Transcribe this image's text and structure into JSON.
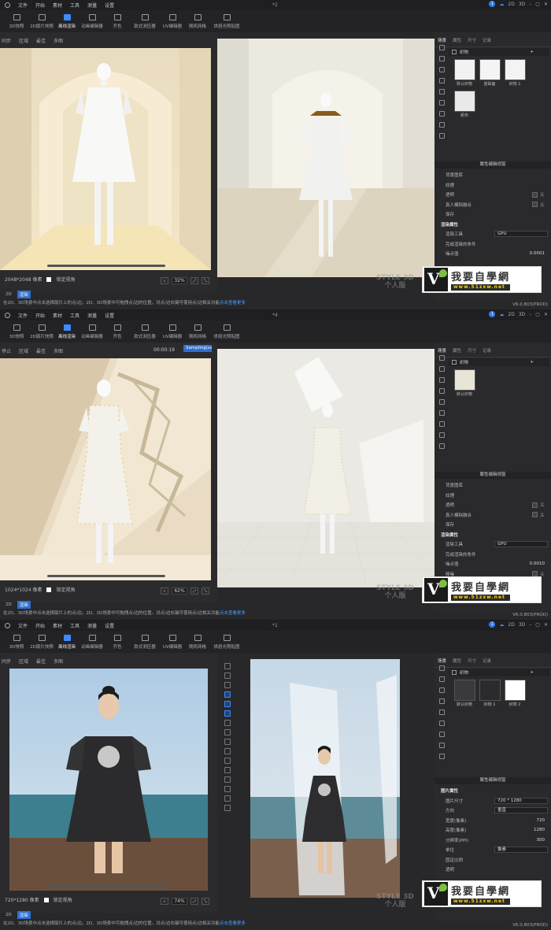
{
  "menu": [
    "文件",
    "开始",
    "素材",
    "工具",
    "测量",
    "设置"
  ],
  "toolbar": [
    {
      "label": "3D快照",
      "icon": "camera-icon"
    },
    {
      "label": "2D版片快照",
      "icon": "pattern-camera-icon"
    },
    {
      "label": "离线渲染",
      "icon": "render-icon",
      "active": true
    },
    {
      "label": "动画编辑器",
      "icon": "animation-icon"
    },
    {
      "label": "齐色",
      "icon": "colorway-icon"
    },
    {
      "label": "款式测压器",
      "icon": "pressure-icon"
    },
    {
      "label": "UV编辑器",
      "icon": "uv-icon"
    },
    {
      "label": "随机网格",
      "icon": "mesh-icon"
    },
    {
      "label": "烘焙光照贴图",
      "icon": "bake-icon"
    }
  ],
  "right_top": {
    "badge": "1",
    "mode_2d": "2D",
    "mode_3d": "3D"
  },
  "right_tabs": [
    "场景",
    "属性",
    "尺寸",
    "记录"
  ],
  "panes": [
    {
      "tab_title": "*2",
      "view_tools": [
        "同步",
        "区域",
        "最佳",
        "多图"
      ],
      "resolution": "2048*2048 像素",
      "lock_label": "锁定视角",
      "zoom": "32%",
      "library_title": "织物",
      "thumbs": [
        {
          "caption": "默认织物"
        },
        {
          "caption": "基础面"
        },
        {
          "caption": "织物 1"
        },
        {
          "caption": "帆布"
        }
      ],
      "prop_header": "属性编辑视窗",
      "props": [
        {
          "label": "背景图库"
        },
        {
          "label": "纹理"
        },
        {
          "label": "透明",
          "value": "关"
        },
        {
          "label": "真人模拟融合",
          "value": "关"
        },
        {
          "label": "保存"
        },
        {
          "label": "渲染属性",
          "section": true
        },
        {
          "label": "渲染工具",
          "dropdown": "GPU"
        },
        {
          "label": "完成渲染的条件"
        },
        {
          "label": "噪点值",
          "value": "0.0001"
        }
      ],
      "mode_tabs": [
        "2D",
        "渲染"
      ]
    },
    {
      "tab_title": "*4",
      "view_tools": [
        "停止",
        "区域",
        "最佳",
        "多图"
      ],
      "timer": "00:00:19",
      "progress_chip": "Sampling(samples)",
      "resolution": "1024*1024 像素",
      "lock_label": "锁定视角",
      "zoom": "62%",
      "library_title": "织物",
      "thumbs": [
        {
          "caption": "默认织物"
        }
      ],
      "prop_header": "属性编辑视窗",
      "props": [
        {
          "label": "背景图库"
        },
        {
          "label": "纹理"
        },
        {
          "label": "透明",
          "value": "关"
        },
        {
          "label": "真人模拟融合",
          "value": "关"
        },
        {
          "label": "保存"
        },
        {
          "label": "渲染属性",
          "section": true
        },
        {
          "label": "渲染工具",
          "dropdown": "GPU"
        },
        {
          "label": "完成渲染的条件"
        },
        {
          "label": "噪点值",
          "value": "0.0010"
        },
        {
          "label": "降噪",
          "value": "关"
        }
      ],
      "mode_tabs": [
        "2D",
        "渲染"
      ]
    },
    {
      "tab_title": "*1",
      "view_tools": [
        "同步",
        "区域",
        "最佳",
        "多图"
      ],
      "resolution": "720*1280 像素",
      "lock_label": "锁定视角",
      "zoom": "74%",
      "library_title": "织物",
      "thumbs": [
        {
          "caption": "默认织物"
        },
        {
          "caption": "织物 1"
        },
        {
          "caption": "织物 2"
        }
      ],
      "prop_header": "属性编辑视窗",
      "props": [
        {
          "label": "图片属性",
          "section": true
        },
        {
          "label": "图片尺寸",
          "dropdown": "720 * 1280"
        },
        {
          "label": "方向",
          "dropdown": "垂直"
        },
        {
          "label": "宽度(像素)",
          "value": "720"
        },
        {
          "label": "高度(像素)",
          "value": "1280"
        },
        {
          "label": "分辨率(PPI)",
          "value": "300"
        },
        {
          "label": "单位",
          "dropdown": "像素"
        },
        {
          "label": "固定比例"
        },
        {
          "label": "透明"
        }
      ],
      "mode_tabs": [
        "2D",
        "渲染"
      ]
    }
  ],
  "hint_text": "在2D、3D场景中点击选择版片上的点/边。2D、3D场景中可拖拽点/边的位置。对点/边右键可使用点/边相关功能",
  "hint_link": "点击查看更多",
  "watermark": {
    "line1": "STYLE 3D",
    "line2": "个人版"
  },
  "logo": {
    "mark": "V",
    "title": "我要自學網",
    "url": "www.51zxw.net"
  },
  "version": "V6.0.803(PROD)",
  "colors": {
    "accent": "#2f6fd0",
    "bg": "#28282b"
  }
}
